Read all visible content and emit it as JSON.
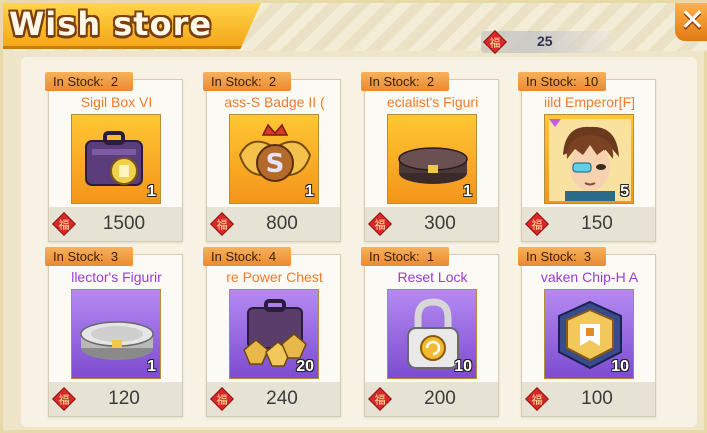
{
  "window": {
    "title": "Wish store",
    "close_symbol": "✕"
  },
  "currency": {
    "icon": "fu-coin-icon",
    "symbol": "福",
    "value": "25"
  },
  "colors": {
    "accent": "#f5a719",
    "orange_tile": "#f4941b",
    "purple_tile": "#7d4bd0"
  },
  "items": [
    {
      "stock_label": "In Stock:",
      "stock": "2",
      "name": "Sigil Box VI",
      "rarity": "orange",
      "icon": "suitcase-icon",
      "quantity": "1",
      "price": "1500"
    },
    {
      "stock_label": "In Stock:",
      "stock": "2",
      "name": "ass-S Badge II (",
      "rarity": "orange",
      "icon": "badge-icon",
      "quantity": "1",
      "price": "800"
    },
    {
      "stock_label": "In Stock:",
      "stock": "2",
      "name": "ecialist's Figuri",
      "rarity": "orange",
      "icon": "figurine-base-icon",
      "quantity": "1",
      "price": "300"
    },
    {
      "stock_label": "In Stock:",
      "stock": "10",
      "name": "iild Emperor[F]",
      "rarity": "orange",
      "icon": "hero-portrait-icon",
      "quantity": "5",
      "price": "150"
    },
    {
      "stock_label": "In Stock:",
      "stock": "3",
      "name": "llector's Figurir",
      "rarity": "purple",
      "icon": "figurine-base-icon",
      "quantity": "1",
      "price": "120"
    },
    {
      "stock_label": "In Stock:",
      "stock": "4",
      "name": "re Power Chest",
      "rarity": "purple",
      "icon": "power-chest-icon",
      "quantity": "20",
      "price": "240"
    },
    {
      "stock_label": "In Stock:",
      "stock": "1",
      "name": "Reset Lock",
      "rarity": "purple",
      "icon": "lock-icon",
      "quantity": "10",
      "price": "200"
    },
    {
      "stock_label": "In Stock:",
      "stock": "3",
      "name": "vaken Chip-H A",
      "rarity": "purple",
      "icon": "chip-icon",
      "quantity": "10",
      "price": "100"
    }
  ]
}
